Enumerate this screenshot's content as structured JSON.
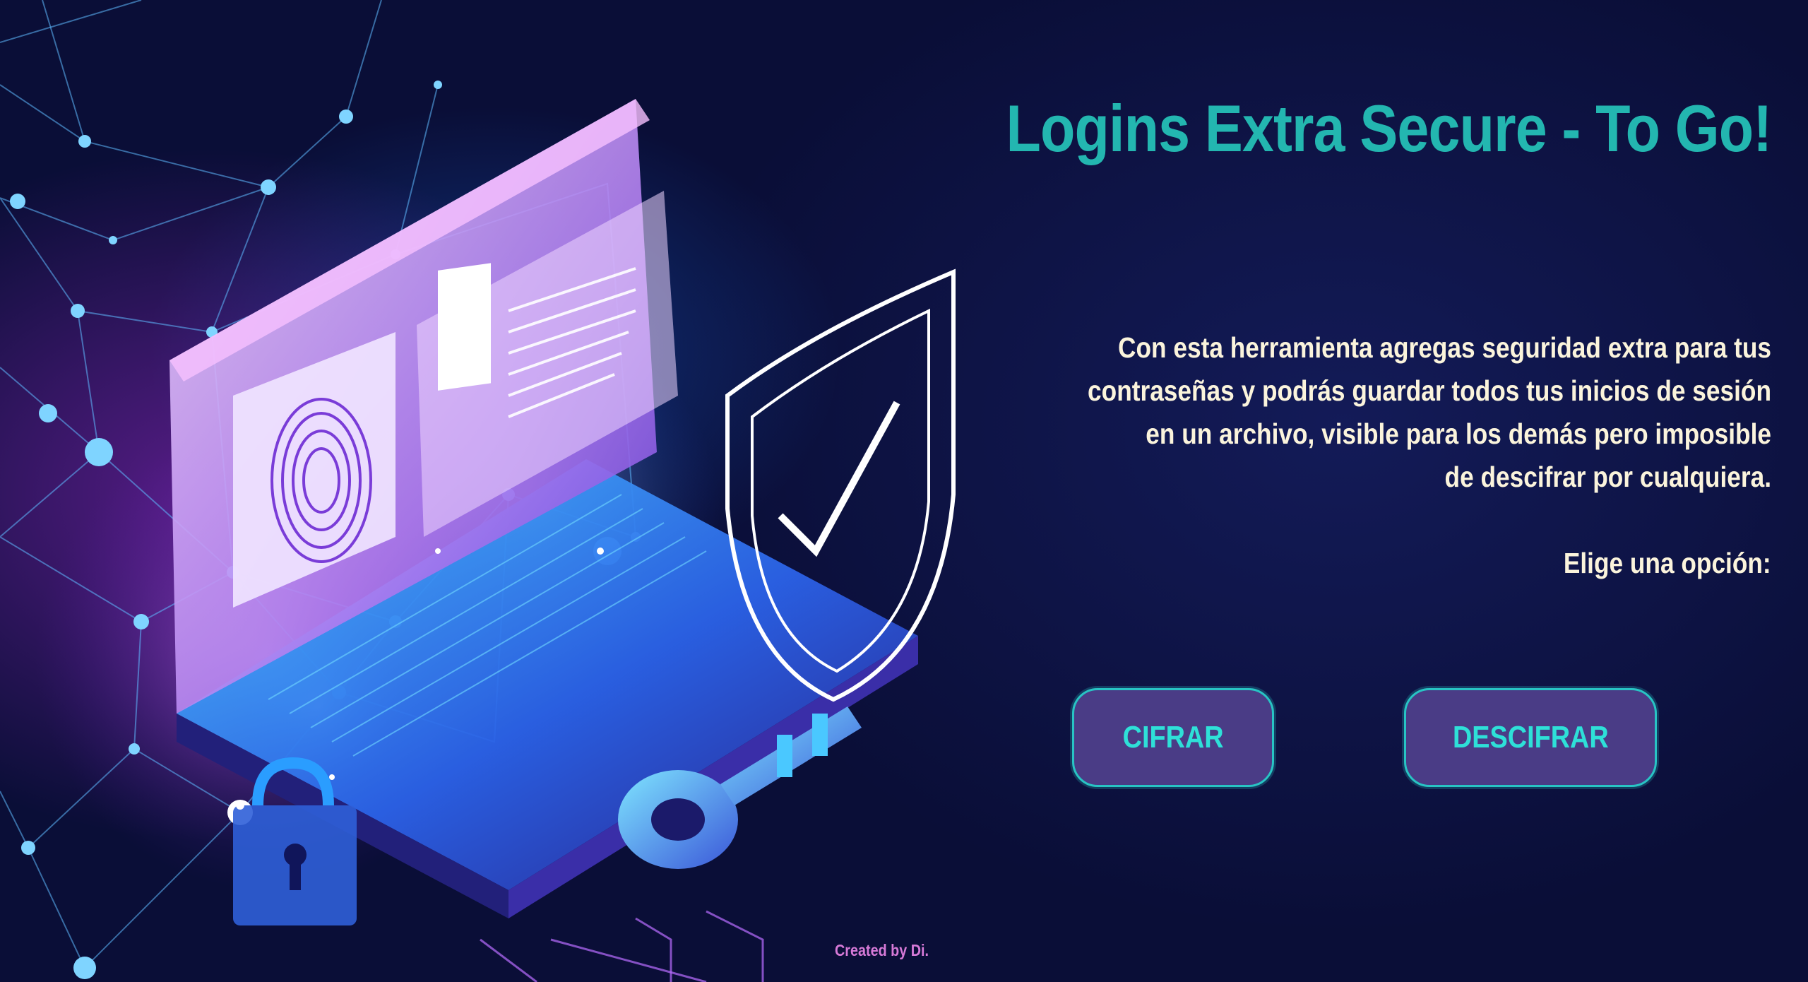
{
  "header": {
    "title": "Logins Extra Secure - To Go!"
  },
  "intro": {
    "description_lines": [
      "Con esta herramienta agregas seguridad extra para tus",
      "contraseñas y podrás guardar todos tus inicios de sesión",
      "en un archivo, visible para los demás pero imposible",
      "de descifrar por cualquiera."
    ],
    "prompt": "Elige una opción:"
  },
  "actions": {
    "encrypt_label": "CIFRAR",
    "decrypt_label": "DESCIFRAR"
  },
  "footer": {
    "credit": "Created by Di."
  },
  "illustration": {
    "icons": [
      "laptop-icon",
      "fingerprint-icon",
      "shield-check-icon",
      "key-icon",
      "padlock-icon",
      "network-mesh"
    ]
  },
  "colors": {
    "accent": "#23b6b0",
    "button_fill": "#4a3c86",
    "button_border": "#28c4c4",
    "button_text": "#2ee0d8",
    "body_text": "#fbf4dc",
    "credit_text": "#d77ad8",
    "background": "#0b0f3e"
  }
}
